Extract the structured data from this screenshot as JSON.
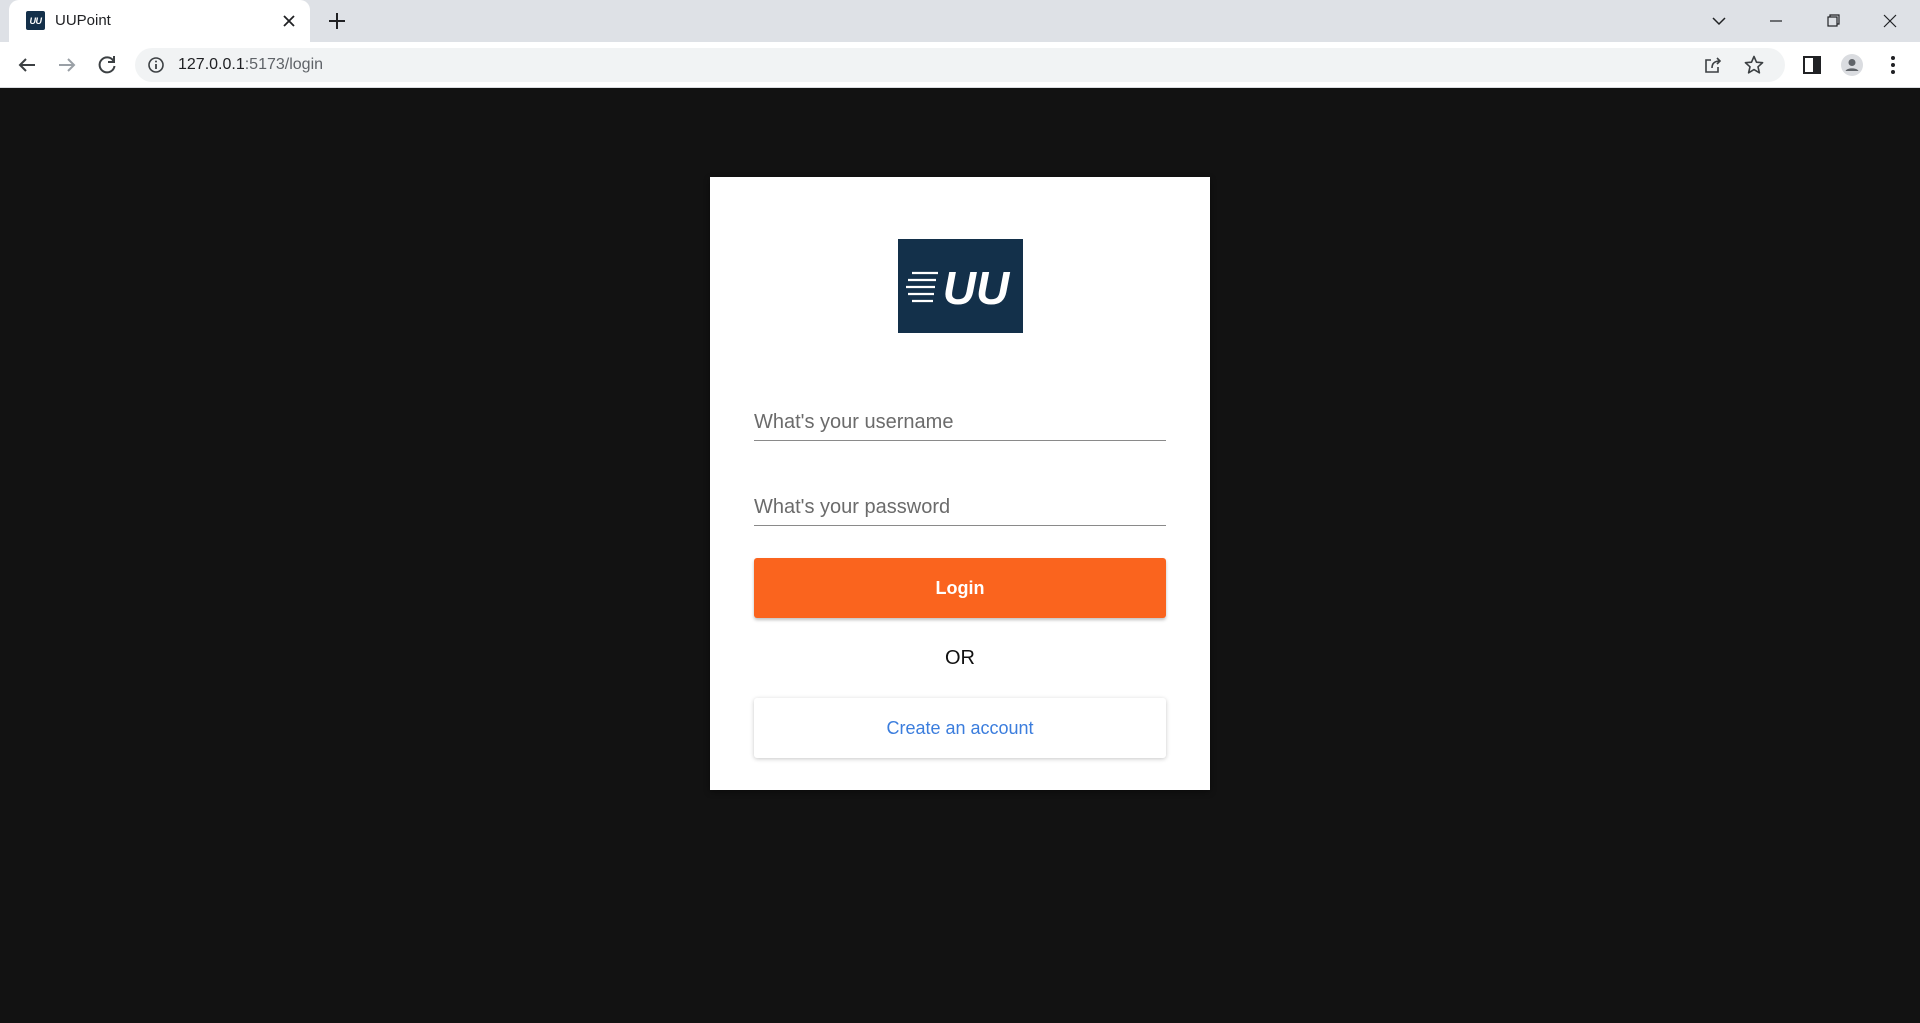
{
  "browser": {
    "tab_title": "UUPoint",
    "favicon_text": "UU",
    "url_host": "127.0.0.1",
    "url_rest": ":5173/login",
    "icons": [
      "close-icon",
      "plus-icon",
      "chevron-down-icon",
      "minimize-icon",
      "restore-icon",
      "window-close-icon",
      "back-arrow-icon",
      "forward-arrow-icon",
      "reload-icon",
      "info-icon",
      "share-icon",
      "star-icon",
      "side-panel-icon",
      "profile-icon",
      "kebab-menu-icon"
    ]
  },
  "login": {
    "logo_text": "UU",
    "username_placeholder": "What's your username",
    "password_placeholder": "What's your password",
    "login_label": "Login",
    "or_label": "OR",
    "create_account_label": "Create an account"
  },
  "colors": {
    "page_background": "#121212",
    "card_background": "#ffffff",
    "logo_background": "#13304a",
    "login_button": "#fa641e",
    "link_text": "#3b7ddd"
  }
}
